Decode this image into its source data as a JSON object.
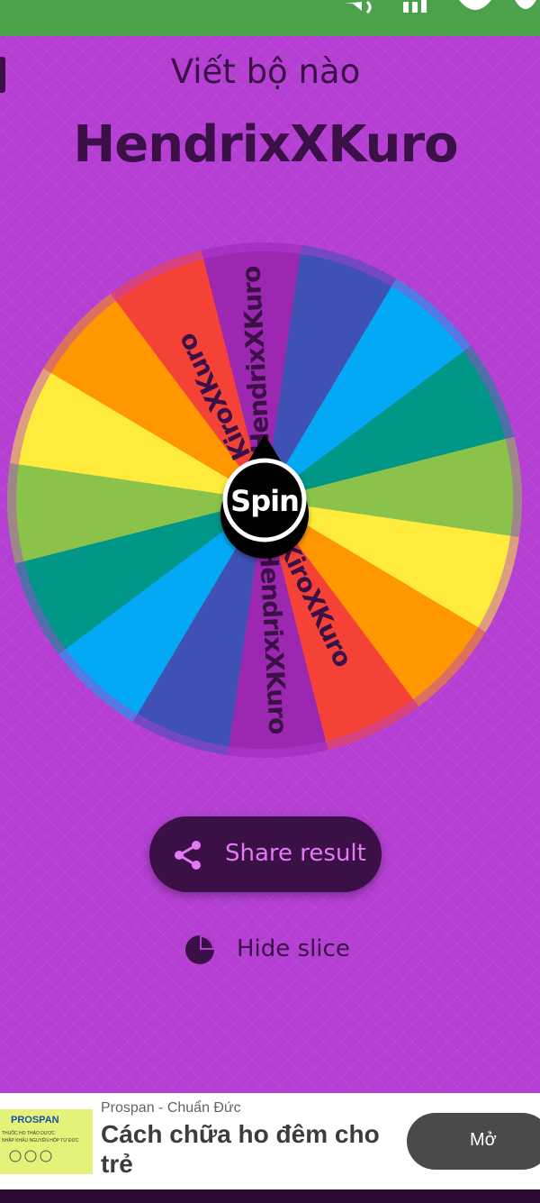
{
  "header": {
    "subtitle": "Viết bộ nào",
    "result": "HendrixXKuro"
  },
  "wheel": {
    "spin_label": "Spin",
    "slices": [
      {
        "label": "HendrixXKuro",
        "color": "#9c27b0"
      },
      {
        "label": "",
        "color": "#3f51b5"
      },
      {
        "label": "",
        "color": "#03a9f4"
      },
      {
        "label": "",
        "color": "#009688"
      },
      {
        "label": "",
        "color": "#8bc34a"
      },
      {
        "label": "",
        "color": "#ffeb3b"
      },
      {
        "label": "",
        "color": "#ff9800"
      },
      {
        "label": "KiroXKuro",
        "color": "#f44336"
      },
      {
        "label": "HendrixXKuro",
        "color": "#9c27b0"
      },
      {
        "label": "",
        "color": "#3f51b5"
      },
      {
        "label": "",
        "color": "#03a9f4"
      },
      {
        "label": "",
        "color": "#009688"
      },
      {
        "label": "",
        "color": "#8bc34a"
      },
      {
        "label": "",
        "color": "#ffeb3b"
      },
      {
        "label": "",
        "color": "#ff9800"
      },
      {
        "label": "KiroXKuro",
        "color": "#f44336"
      }
    ]
  },
  "actions": {
    "share_label": "Share result",
    "hide_label": "Hide slice"
  },
  "ad": {
    "advertiser": "Prospan - Chuẩn Đức",
    "headline": "Cách chữa ho đêm cho trẻ",
    "cta": "Mở",
    "image_brand": "PROSPAN",
    "image_line1": "THUỐC HO THẢO DƯỢC",
    "image_line2": "NHẬP KHẨU NGUYÊN HỘP TỪ ĐỨC"
  },
  "colors": {
    "background": "#b43fd2",
    "dark": "#3b1046",
    "status_bar": "#4ca24a",
    "share_text": "#e678f5"
  }
}
